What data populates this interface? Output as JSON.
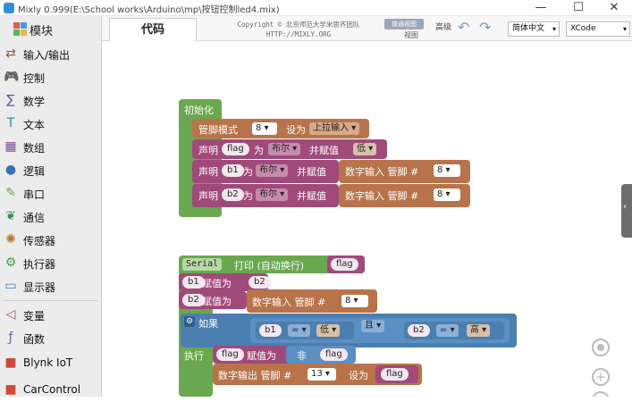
{
  "window": {
    "title": "Mixly 0.999(E:\\School works\\Arduino\\mp\\按钮控制led4.mix)",
    "minimize": "—",
    "maximize": "☐",
    "close": "✕"
  },
  "sidebar": {
    "header": "模块",
    "categories": [
      {
        "label": "输入/输出",
        "icon": "io-icon",
        "color": "#8a5a44"
      },
      {
        "label": "控制",
        "icon": "gamepad-icon",
        "color": "#6aa84f"
      },
      {
        "label": "数学",
        "icon": "math-icon",
        "color": "#4a5ba8"
      },
      {
        "label": "文本",
        "icon": "text-icon",
        "color": "#2a8a8a"
      },
      {
        "label": "数组",
        "icon": "array-icon",
        "color": "#7c4a9a"
      },
      {
        "label": "逻辑",
        "icon": "bulb-icon",
        "color": "#3e6fb0"
      },
      {
        "label": "串口",
        "icon": "pen-icon",
        "color": "#6aa84f"
      },
      {
        "label": "通信",
        "icon": "leaf-icon",
        "color": "#3a8a5a"
      },
      {
        "label": "传感器",
        "icon": "sensor-icon",
        "color": "#b07a30"
      },
      {
        "label": "执行器",
        "icon": "actuator-icon",
        "color": "#4a9a4a"
      },
      {
        "label": "显示器",
        "icon": "monitor-icon",
        "color": "#3a7ab0"
      },
      {
        "label": "变量",
        "icon": "variable-icon",
        "color": "#a04a7a"
      },
      {
        "label": "函数",
        "icon": "function-icon",
        "color": "#7a5aa0"
      },
      {
        "label": "Blynk IoT",
        "icon": "cube-icon",
        "color": "#d04a3a"
      },
      {
        "label": "CarControl",
        "icon": "cube-icon",
        "color": "#d04a3a"
      }
    ]
  },
  "toolbar": {
    "code_tab": "代码",
    "copyright_line1": "Copyright © 北京师范大学米思齐团队",
    "copyright_line2": "HTTP://MIXLY.ORG",
    "view_toggle": "普通视图",
    "view_label": "视图",
    "advanced": "高级",
    "language": "简体中文",
    "theme": "XCode"
  },
  "blocks": {
    "setup": {
      "hat": "初始化",
      "pinmode": {
        "label": "管脚模式",
        "pin": "8",
        "set_as": "设为",
        "mode": "上拉输入"
      },
      "declare1": {
        "label": "声明",
        "var": "flag",
        "as": "为",
        "type": "布尔",
        "assign": "并赋值",
        "value": "低"
      },
      "declare2": {
        "label": "声明",
        "var": "b1",
        "as": "为",
        "type": "布尔",
        "assign": "并赋值",
        "read": "数字输入 管脚 #",
        "pin": "8"
      },
      "declare3": {
        "label": "声明",
        "var": "b2",
        "as": "为",
        "type": "布尔",
        "assign": "并赋值",
        "read": "数字输入 管脚 #",
        "pin": "8"
      }
    },
    "loop": {
      "serial": {
        "label": "Serial",
        "print": "打印 (自动换行)",
        "var": "flag"
      },
      "assign_b1": {
        "var": "b1",
        "assign": "赋值为",
        "src": "b2"
      },
      "assign_b2": {
        "var": "b2",
        "assign": "赋值为",
        "read": "数字输入 管脚 #",
        "pin": "8"
      },
      "if": {
        "label": "如果",
        "lhs1": "b1",
        "op1": "=",
        "rhs1": "低",
        "and": "且",
        "lhs2": "b2",
        "op2": "=",
        "rhs2": "高"
      },
      "do": {
        "label": "执行",
        "var": "flag",
        "assign": "赋值为",
        "not": "非",
        "src": "flag"
      },
      "write": {
        "label": "数字输出 管脚 #",
        "pin": "13",
        "set_as": "设为",
        "var": "flag"
      }
    }
  }
}
